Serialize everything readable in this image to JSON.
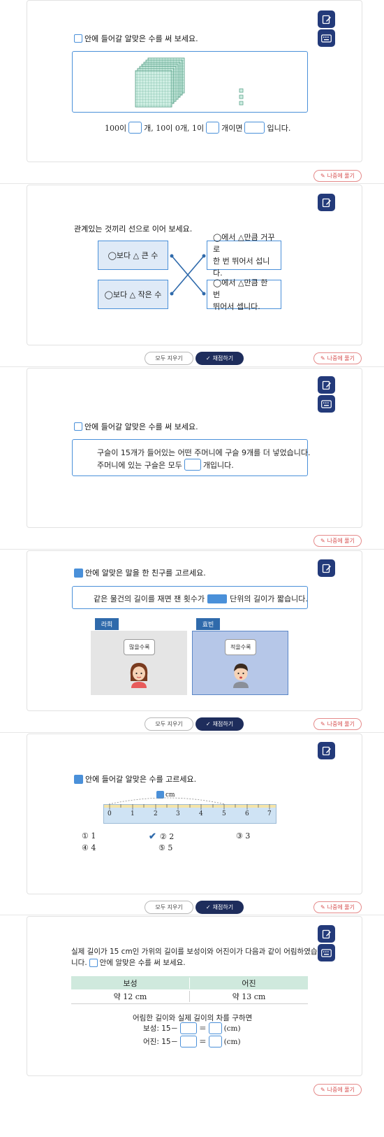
{
  "common": {
    "later_label": "나중에 풀기",
    "clear_label": "모두 지우기",
    "grade_label": "채점하기"
  },
  "q1": {
    "instruction": "안에 들어갈 알맞은 수를 써 보세요.",
    "sentence_parts": [
      "100이",
      "개, 10이 0개, 1이",
      "개이면",
      "입니다."
    ]
  },
  "q2": {
    "instruction": "관계있는 것끼리 선으로 이어 보세요.",
    "left_items": [
      "◯보다 △ 큰 수",
      "◯보다 △ 작은 수"
    ],
    "right_items": [
      [
        "◯에서 △만큼 거꾸로",
        "한 번 뛰어서 섭니다."
      ],
      [
        "◯에서 △만큼 한 번",
        "뛰어서 셉니다."
      ]
    ]
  },
  "q3": {
    "instruction": "안에 들어갈 알맞은 수를 써 보세요.",
    "line1": "구슬이 15개가 들어있는 어떤 주머니에 구슬 9개를 더 넣었습니다.",
    "line2_before": "주머니에 있는 구슬은 모두",
    "line2_after": "개입니다."
  },
  "q4": {
    "instruction": "안에 알맞은 말을 한 친구를 고르세요.",
    "sentence_before": "같은 물건의 길이를 재면 잰 횟수가",
    "sentence_after": "단위의 길이가 짧습니다.",
    "friends": [
      {
        "name": "라희",
        "speech": "많을수록"
      },
      {
        "name": "효빈",
        "speech": "적을수록"
      }
    ]
  },
  "q5": {
    "instruction": "안에 들어갈 알맞은 수를 고르세요.",
    "unit": "cm",
    "ruler_numbers": [
      "0",
      "1",
      "2",
      "3",
      "4",
      "5",
      "6",
      "7"
    ],
    "choices": [
      {
        "label": "① 1",
        "checked": false
      },
      {
        "label": "② 2",
        "checked": true
      },
      {
        "label": "③ 3",
        "checked": false
      },
      {
        "label": "④ 4",
        "checked": false
      },
      {
        "label": "⑤ 5",
        "checked": false
      }
    ]
  },
  "q6": {
    "intro_line1": "실제 길이가 15 cm인 가위의 길이를 보성이와 어진이가 다음과 같이 어림하였습",
    "intro_line2_before": "니다.",
    "intro_line2_after": "안에 알맞은 수를 써 보세요.",
    "table_headers": [
      "보성",
      "어진"
    ],
    "table_values": [
      "약 12 cm",
      "약 13 cm"
    ],
    "calc_title": "어림한 길이와 실제 길이의 차를 구하면",
    "row1_label": "보성: 15－",
    "row2_label": "어진: 15－",
    "equals": "＝",
    "unit": "(cm)"
  },
  "colors": {
    "accent_blue": "#4a90d9",
    "navy": "#233a7a",
    "later_red": "#d75050"
  }
}
